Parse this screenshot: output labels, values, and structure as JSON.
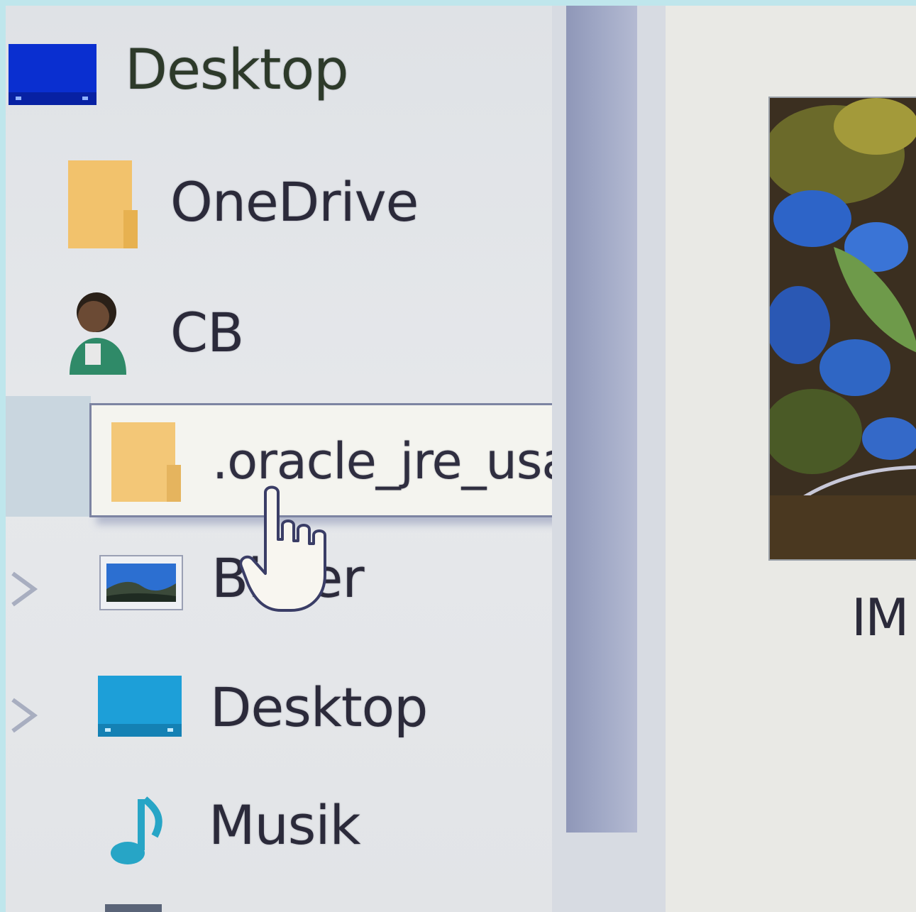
{
  "navigation": {
    "items": [
      {
        "label": "Desktop",
        "icon": "desktop-icon",
        "level": 0
      },
      {
        "label": "OneDrive",
        "icon": "folder-icon",
        "level": 1
      },
      {
        "label": "CB",
        "icon": "user-icon",
        "level": 1
      },
      {
        "label": "Bilder",
        "icon": "pictures-icon",
        "level": 1,
        "expandable": true
      },
      {
        "label": "Desktop",
        "icon": "desktop-icon",
        "level": 1,
        "expandable": true
      },
      {
        "label": "Musik",
        "icon": "music-icon",
        "level": 1
      }
    ]
  },
  "drag_item": {
    "label": ".oracle_jre_usage",
    "icon": "folder-icon"
  },
  "content": {
    "file_caption": "IM"
  },
  "colors": {
    "folder": "#f2c26c",
    "desktop_blue": "#0a2fd0",
    "desktop_cyan": "#1d9fd8",
    "music": "#27a5c6",
    "selection": "#c9d6df",
    "scroll_thumb": "#9aa2c2"
  }
}
